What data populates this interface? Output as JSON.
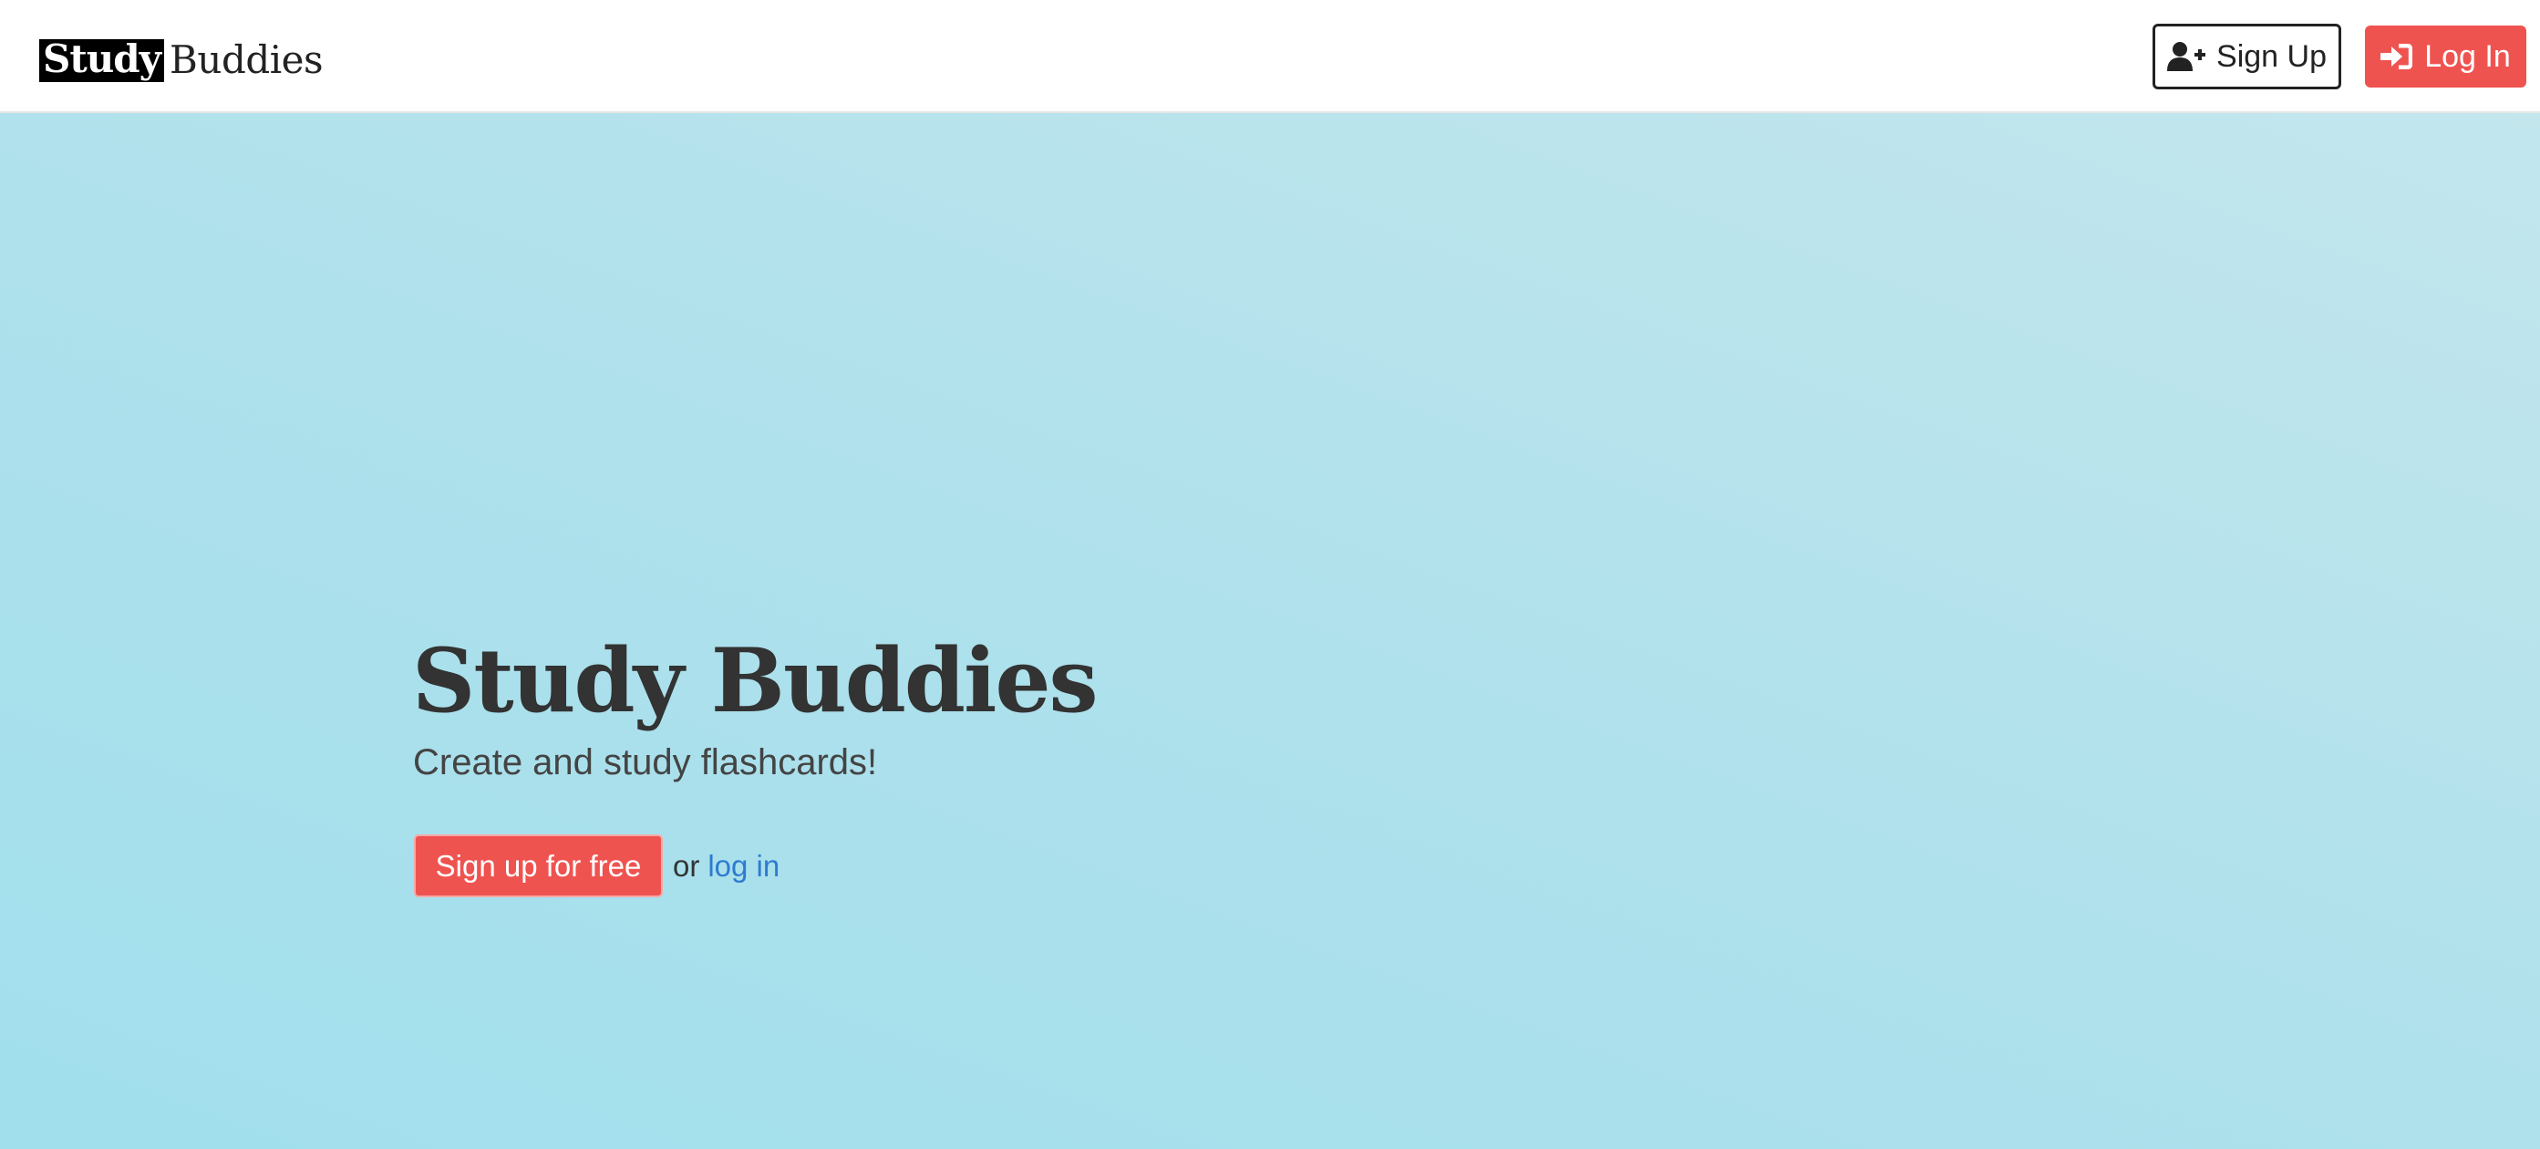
{
  "navbar": {
    "brand_part1": "Study",
    "brand_part2": "Buddies",
    "signup_label": "Sign Up",
    "signup_icon": "user-plus-icon",
    "login_label": "Log In",
    "login_icon": "sign-in-icon"
  },
  "hero": {
    "title": "Study Buddies",
    "subtitle": "Create and study flashcards!",
    "cta_label": "Sign up for free",
    "or_text": "or",
    "login_link": "log in"
  },
  "colors": {
    "accent_red": "#ef5350",
    "link_blue": "#2e7bcf",
    "hero_bg": "#a1dfed"
  }
}
